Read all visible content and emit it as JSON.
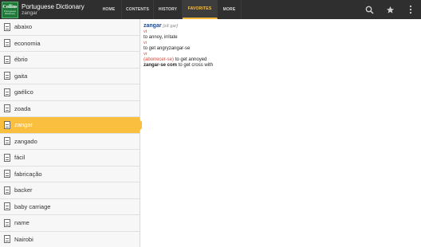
{
  "header": {
    "logo": {
      "line1": "Collins",
      "line2": "Portuguese",
      "line3": "Dictionary"
    },
    "title": "Portuguese Dictionary",
    "subtitle": "zangar"
  },
  "tabs": [
    {
      "label": "HOME",
      "active": false
    },
    {
      "label": "CONTENTS",
      "active": false
    },
    {
      "label": "HISTORY",
      "active": false
    },
    {
      "label": "FAVORITES",
      "active": true
    },
    {
      "label": "MORE",
      "active": false
    }
  ],
  "actions": {
    "search_icon": "search-icon",
    "favorite_icon": "star-icon",
    "menu_icon": "overflow-menu-icon"
  },
  "word_list": [
    "abaixo",
    "economia",
    "ébrio",
    "gaita",
    "gaélico",
    "zoada",
    "zangar",
    "zangado",
    "fácil",
    "fabricação",
    "backer",
    "baby carriage",
    "name",
    "Nairobi"
  ],
  "selected_index": 6,
  "entry": {
    "headword": "zangar",
    "pronunciation": "[zãˈgar]",
    "sense1_pos": "vt",
    "sense1_def": "to annoy, irritate",
    "sense2_pos": "vi",
    "sense2_def": "to get angry",
    "sense2_def_extra": "zangar-se",
    "sense3_pos": "vr",
    "sense3_xref": "(aborrecer-se)",
    "sense3_def": "to get annoyed",
    "phrase": "zangar-se com",
    "phrase_def": "to get cross with"
  },
  "colors": {
    "accent": "#fbbf3f",
    "topbar": "#2f2f2f",
    "headword": "#23498a",
    "pos": "#d44a3c"
  }
}
